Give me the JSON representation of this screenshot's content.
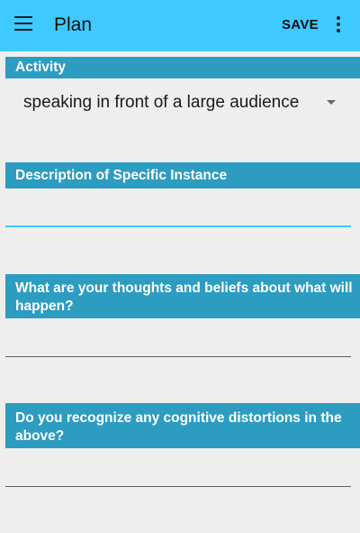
{
  "appbar": {
    "title": "Plan",
    "save_label": "SAVE",
    "menu_icon": "hamburger-menu-icon",
    "overflow_icon": "more-vert-icon",
    "background_color": "#3ec9ff"
  },
  "sections": {
    "activity": {
      "header": "Activity",
      "selected_value": "speaking in front of a large audience"
    },
    "description": {
      "header": "Description of Specific Instance",
      "value": ""
    },
    "thoughts": {
      "header": "What are your thoughts and beliefs about what will happen?",
      "value": ""
    },
    "distortions": {
      "header": "Do you recognize any cognitive distortions in the above?",
      "value": ""
    }
  },
  "colors": {
    "section_header": "#2d9cc1",
    "active_underline": "#3ec9ff",
    "page_background": "#eeeeee"
  }
}
